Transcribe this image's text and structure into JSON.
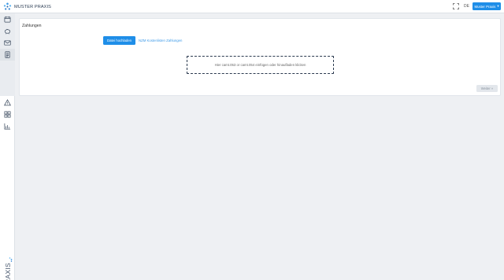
{
  "header": {
    "app_name": "MUSTER PRAXIS",
    "language": "DE",
    "user_button": "Muster Praxis",
    "brand_color": "#1f8ee8"
  },
  "sidebar": {
    "top_items": [
      {
        "icon": "calendar-icon"
      },
      {
        "icon": "piggy-bank-icon"
      },
      {
        "icon": "mail-icon"
      },
      {
        "icon": "document-icon",
        "active": true
      }
    ],
    "bottom_items": [
      {
        "icon": "warning-icon"
      },
      {
        "icon": "grid-icon"
      },
      {
        "icon": "chart-icon"
      }
    ],
    "brand": "PRAXIS"
  },
  "card": {
    "title": "Zahlungen",
    "upload_button": "Datei hochladen",
    "link_text": "NZM Kostenlisten Zahlungen",
    "dropzone_text": "Hier camt.053 or camt.054 einfügen oder hinaufladen klicken",
    "next_button": "Weiter",
    "next_icon": "chevron-double-right-icon"
  }
}
